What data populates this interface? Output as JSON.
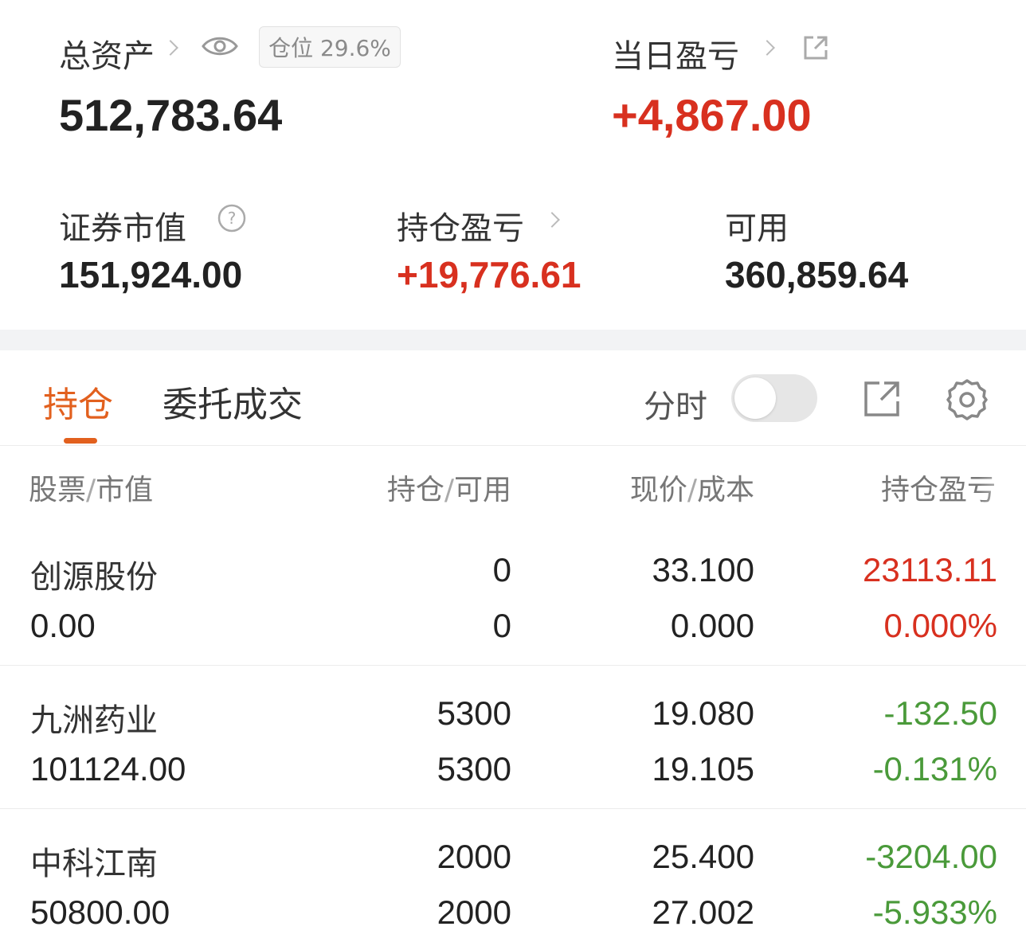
{
  "summary": {
    "total_assets_label": "总资产",
    "position_badge": "仓位 29.6%",
    "total_assets_value": "512,783.64",
    "daily_pnl_label": "当日盈亏",
    "daily_pnl_value": "+4,867.00",
    "market_value_label": "证券市值",
    "market_value": "151,924.00",
    "holding_pnl_label": "持仓盈亏",
    "holding_pnl_value": "+19,776.61",
    "available_label": "可用",
    "available_value": "360,859.64"
  },
  "tabs": {
    "holdings": "持仓",
    "orders": "委托成交",
    "intraday_label": "分时",
    "intraday_on": false
  },
  "table": {
    "headers": {
      "stock": "股票",
      "market": "市值",
      "position": "持仓",
      "available": "可用",
      "price": "现价",
      "cost": "成本",
      "pnl": "持仓盈亏",
      "sep": "/"
    },
    "rows": [
      {
        "name": "创源股份",
        "market_value": "0.00",
        "position": "0",
        "available": "0",
        "price": "33.100",
        "cost": "0.000",
        "pnl": "23113.11",
        "pnl_pct": "0.000%",
        "trend": "up"
      },
      {
        "name": "九洲药业",
        "market_value": "101124.00",
        "position": "5300",
        "available": "5300",
        "price": "19.080",
        "cost": "19.105",
        "pnl": "-132.50",
        "pnl_pct": "-0.131%",
        "trend": "down"
      },
      {
        "name": "中科江南",
        "market_value": "50800.00",
        "position": "2000",
        "available": "2000",
        "price": "25.400",
        "cost": "27.002",
        "pnl": "-3204.00",
        "pnl_pct": "-5.933%",
        "trend": "down"
      }
    ]
  },
  "colors": {
    "up": "#d8301f",
    "down": "#4a9a3a",
    "accent": "#e2601e"
  },
  "icons": [
    "chevron-right-icon",
    "eye-icon",
    "external-link-icon",
    "help-circle-icon",
    "gear-icon"
  ]
}
